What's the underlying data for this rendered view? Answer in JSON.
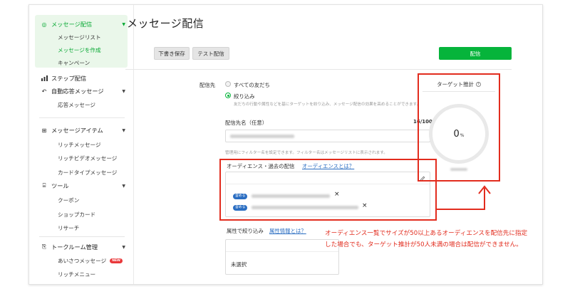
{
  "sidebar": {
    "sections": [
      {
        "label": "メッセージ配信",
        "icon": "broadcast-icon",
        "active": true,
        "caret": "▼"
      },
      {
        "label": "ステップ配信",
        "icon": "step-chart-icon"
      },
      {
        "label": "自動応答メッセージ",
        "icon": "auto-reply-icon",
        "caret": "▼"
      },
      {
        "label": "メッセージアイテム",
        "icon": "plus-box-icon",
        "caret": "▼"
      },
      {
        "label": "ツール",
        "icon": "tool-icon",
        "caret": "▼"
      },
      {
        "label": "トークルーム管理",
        "icon": "talkroom-icon",
        "caret": "▼"
      }
    ],
    "items": {
      "message_list": "メッセージリスト",
      "create_message": "メッセージを作成",
      "campaign": "キャンペーン",
      "response_message": "応答メッセージ",
      "rich_message": "リッチメッセージ",
      "rich_video_message": "リッチビデオメッセージ",
      "card_type_message": "カードタイプメッセージ",
      "coupon": "クーポン",
      "shop_card": "ショップカード",
      "research": "リサーチ",
      "greeting_message": "あいさつメッセージ",
      "rich_menu": "リッチメニュー"
    },
    "new_badge": "NEW"
  },
  "main": {
    "title": "メッセージ配信",
    "save_draft": "下書き保存",
    "test_send": "テスト配信",
    "send": "配信",
    "recipient_label": "配信先",
    "all_friends": "すべての友だち",
    "narrow_down": "絞り込み",
    "narrow_help": "友だちの行動や属性などを基にターゲットを絞り込み、メッセージ配信の効果を高めることができます。",
    "recipient_name_label": "配信先名（任意）",
    "recipient_name_counter": "16/100",
    "filter_help": "管理用にフィルター名を設定できます。フィルター名はメッセージリストに表示されます。",
    "audience_label": "オーディエンス・過去の配信",
    "audience_link": "オーディエンスとは？",
    "include_tag": "含める",
    "remove_icon": "×",
    "attribute_label": "属性で絞り込み",
    "attribute_link": "属性情報とは？",
    "unselected": "未選択"
  },
  "target": {
    "header": "ターゲット推計",
    "info_icon": "?",
    "value": "0",
    "unit": "%"
  },
  "annotation": {
    "note": "オーディエンス一覧でサイズが50以上あるオーディエンスを配信先に指定した場合でも、ターゲット推計が50人未満の場合は配信ができません。"
  },
  "colors": {
    "brand_green": "#06b43b",
    "active_green": "#06a832",
    "annotation_red": "#e22c1e",
    "link_blue": "#2b6ec2",
    "new_badge_red": "#e9383a"
  }
}
